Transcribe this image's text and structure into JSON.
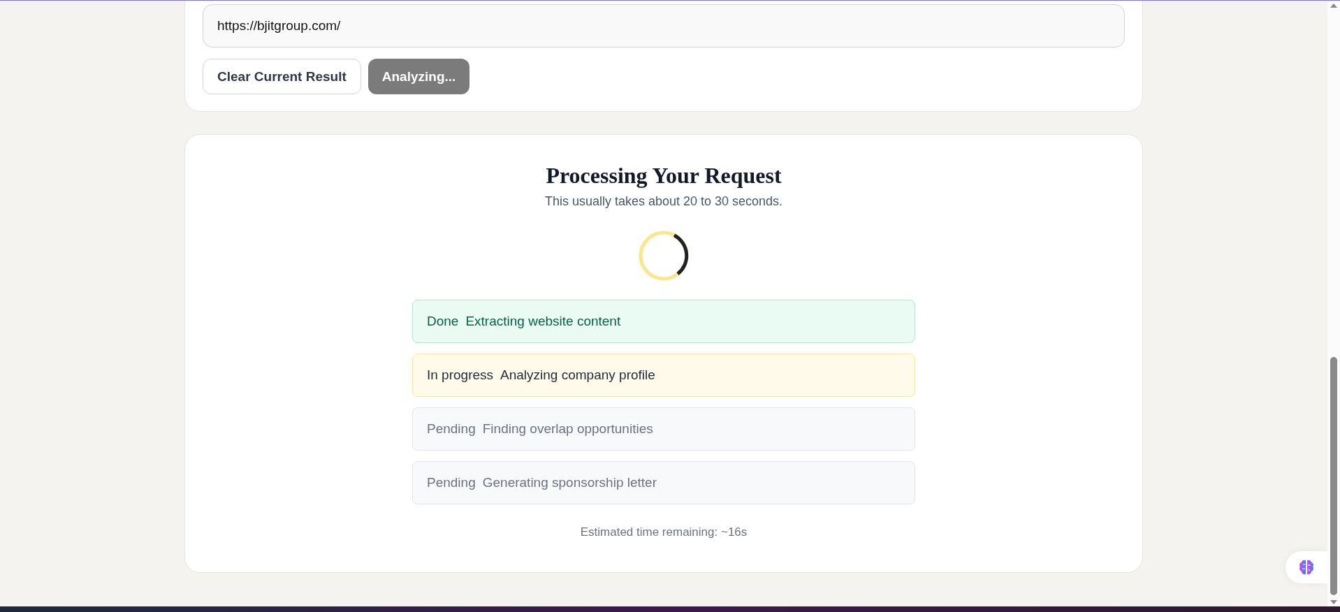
{
  "url_field": {
    "value": "https://bjitgroup.com/"
  },
  "buttons": [
    {
      "kind": "secondary",
      "label": "Clear Current Result",
      "disabled": false
    },
    {
      "kind": "primary",
      "label": "Analyzing...",
      "disabled": true
    }
  ],
  "progress": {
    "title": "Processing Your Request",
    "subtitle": "This usually takes about 20 to 30 seconds.",
    "steps": [
      {
        "kind": "done",
        "status": "Done",
        "text": "Extracting website content"
      },
      {
        "kind": "in_progress",
        "status": "In progress",
        "text": "Analyzing company profile"
      },
      {
        "kind": "pending",
        "status": "Pending",
        "text": "Finding overlap opportunities"
      },
      {
        "kind": "pending",
        "status": "Pending",
        "text": "Generating sponsorship letter"
      }
    ],
    "estimate": "Estimated time remaining: ~16s"
  }
}
